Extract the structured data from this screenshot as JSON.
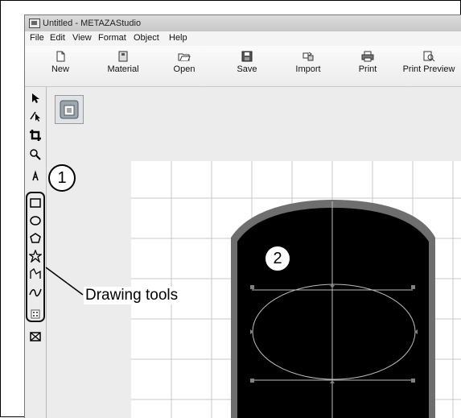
{
  "window": {
    "title": "Untitled - METAZAStudio"
  },
  "menu": [
    "File",
    "Edit",
    "View",
    "Format",
    "Object",
    "Help"
  ],
  "toolbar": [
    {
      "label": "New",
      "icon": "new-document-icon"
    },
    {
      "label": "Material",
      "icon": "material-icon"
    },
    {
      "label": "Open",
      "icon": "open-folder-icon"
    },
    {
      "label": "Save",
      "icon": "save-disk-icon"
    },
    {
      "label": "Import",
      "icon": "import-icon"
    },
    {
      "label": "Print",
      "icon": "printer-icon"
    },
    {
      "label": "Print Preview",
      "icon": "print-preview-icon"
    }
  ],
  "tools": [
    "select-arrow-icon",
    "node-edit-icon",
    "crop-icon",
    "zoom-icon",
    "text-icon",
    "rectangle-icon",
    "ellipse-icon",
    "polygon-icon",
    "star-icon",
    "arc-icon",
    "freehand-icon",
    "barcode-icon",
    "image-frame-icon"
  ],
  "annotations": {
    "marker_1": "1",
    "marker_2": "2",
    "callout": "Drawing tools"
  },
  "colors": {
    "shape_fill": "#000000",
    "shape_border": "#6e6e6e",
    "grid_line": "#c8c8c8",
    "selection_handle": "#808080"
  }
}
